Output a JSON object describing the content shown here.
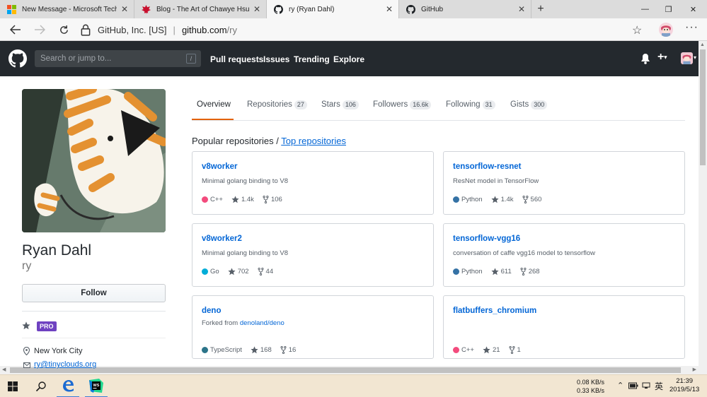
{
  "browser": {
    "tabs": [
      {
        "title": "New Message - Microsoft Tech C",
        "active": false
      },
      {
        "title": "Blog - The Art of Chawye Hsu",
        "active": false
      },
      {
        "title": "ry (Ryan Dahl)",
        "active": true
      },
      {
        "title": "GitHub",
        "active": false
      }
    ],
    "address": {
      "org": "GitHub, Inc. [US]",
      "host": "github.com",
      "path": "/ry"
    }
  },
  "github_header": {
    "search_placeholder": "Search or jump to...",
    "search_shortcut": "/",
    "nav": [
      "Pull requests",
      "Issues",
      "Trending",
      "Explore"
    ]
  },
  "profile": {
    "name": "Ryan Dahl",
    "login": "ry",
    "follow_label": "Follow",
    "badge": "PRO",
    "location": "New York City",
    "email": "ry@tinyclouds.org"
  },
  "tabs": [
    {
      "label": "Overview",
      "count": ""
    },
    {
      "label": "Repositories",
      "count": "27"
    },
    {
      "label": "Stars",
      "count": "106"
    },
    {
      "label": "Followers",
      "count": "16.6k"
    },
    {
      "label": "Following",
      "count": "31"
    },
    {
      "label": "Gists",
      "count": "300"
    }
  ],
  "popular": {
    "prefix": "Popular repositories / ",
    "link": "Top repositories"
  },
  "repos": [
    {
      "name": "v8worker",
      "desc": "Minimal golang binding to V8",
      "lang": "C++",
      "color": "#f34b7d",
      "stars": "1.4k",
      "forks": "106"
    },
    {
      "name": "tensorflow-resnet",
      "desc": "ResNet model in TensorFlow",
      "lang": "Python",
      "color": "#3572a5",
      "stars": "1.4k",
      "forks": "560"
    },
    {
      "name": "v8worker2",
      "desc": "Minimal golang binding to V8",
      "lang": "Go",
      "color": "#00add8",
      "stars": "702",
      "forks": "44"
    },
    {
      "name": "tensorflow-vgg16",
      "desc": "conversation of caffe vgg16 model to tensorflow",
      "lang": "Python",
      "color": "#3572a5",
      "stars": "611",
      "forks": "268"
    },
    {
      "name": "deno",
      "desc_prefix": "Forked from ",
      "desc_link": "denoland/deno",
      "lang": "TypeScript",
      "color": "#2b7489",
      "stars": "168",
      "forks": "16"
    },
    {
      "name": "flatbuffers_chromium",
      "desc": "",
      "lang": "C++",
      "color": "#f34b7d",
      "stars": "21",
      "forks": "1"
    }
  ],
  "taskbar": {
    "net_up": "0.08 KB/s",
    "net_down": "0.33 KB/s",
    "ime": "英",
    "time": "21:39",
    "date": "2019/5/13"
  }
}
